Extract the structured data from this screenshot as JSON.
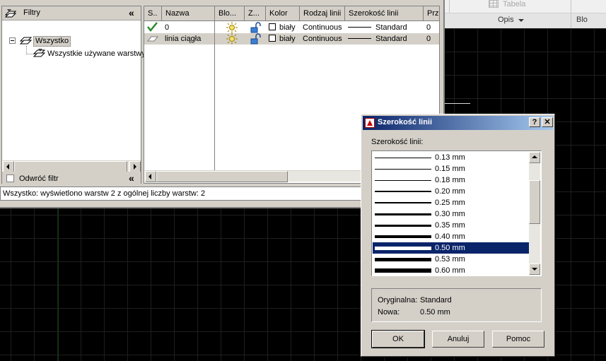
{
  "ribbon": {
    "table_label": "Tabela",
    "panel_label": "Opis",
    "next_panel_label": "Blo"
  },
  "layer_manager": {
    "filter_pane": {
      "title": "Filtry",
      "tree": [
        {
          "label": "Wszystko",
          "selected": true
        },
        {
          "label": "Wszystkie używane warstwy"
        }
      ],
      "invert_filter_label": "Odwróć filtr"
    },
    "columns": [
      "S..",
      "Nazwa",
      "Blo...",
      "Z...",
      "Kolor",
      "Rodzaj linii",
      "Szerokość linii",
      "Prz"
    ],
    "layers": [
      {
        "name": "0",
        "current": true,
        "color": "biały",
        "linetype": "Continuous",
        "lineweight": "Standard",
        "transparency": "0"
      },
      {
        "name": "linia ciągła",
        "current": false,
        "selected": true,
        "color": "biały",
        "linetype": "Continuous",
        "lineweight": "Standard",
        "transparency": "0"
      }
    ],
    "status": "Wszystko: wyświetlono warstw 2 z ogólnej liczby warstw: 2"
  },
  "dialog": {
    "title": "Szerokość linii",
    "list_label": "Szerokość linii:",
    "lineweights": [
      {
        "label": "0.13 mm",
        "weight": 0.13
      },
      {
        "label": "0.15 mm",
        "weight": 0.15
      },
      {
        "label": "0.18 mm",
        "weight": 0.18
      },
      {
        "label": "0.20 mm",
        "weight": 0.2
      },
      {
        "label": "0.25 mm",
        "weight": 0.25
      },
      {
        "label": "0.30 mm",
        "weight": 0.3
      },
      {
        "label": "0.35 mm",
        "weight": 0.35
      },
      {
        "label": "0.40 mm",
        "weight": 0.4
      },
      {
        "label": "0.50 mm",
        "weight": 0.5,
        "selected": true
      },
      {
        "label": "0.53 mm",
        "weight": 0.53
      },
      {
        "label": "0.60 mm",
        "weight": 0.6
      }
    ],
    "original_label": "Oryginalna:",
    "original_value": "Standard",
    "new_label": "Nowa:",
    "new_value": "0.50 mm",
    "ok_label": "OK",
    "cancel_label": "Anuluj",
    "help_label": "Pomoc",
    "help_button_glyph": "?",
    "close_button_glyph": "✕"
  }
}
